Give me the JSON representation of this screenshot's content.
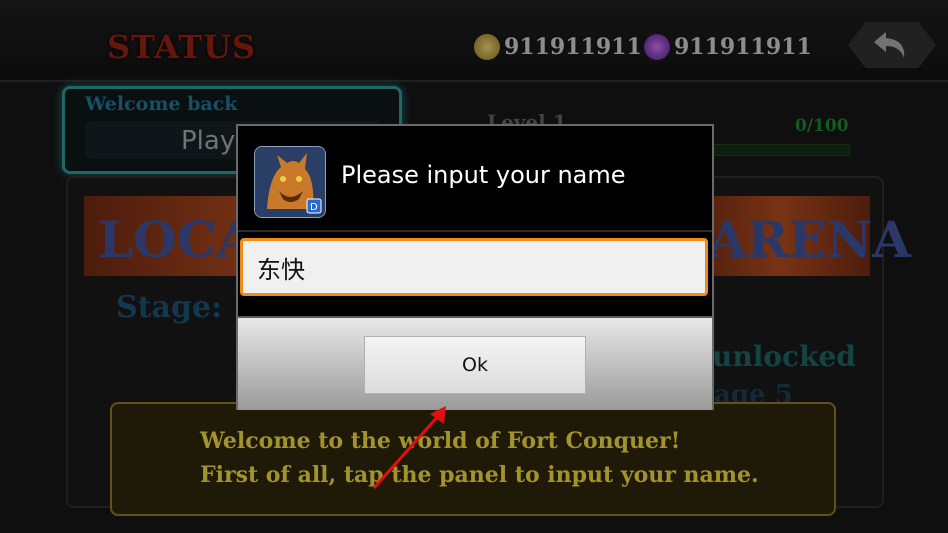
{
  "header": {
    "title": "STATUS",
    "gold_amount": "911911911",
    "gem_amount": "911911911",
    "back_icon": "back-arrow-icon"
  },
  "profile": {
    "welcome_label": "Welcome back",
    "player_name": "Player",
    "level_label": "Level 1",
    "xp_progress_text": "0/100",
    "xp_progress": 0
  },
  "modes": {
    "local_title": "LOCAL",
    "arena_title": "ARENA",
    "stage_label": "Stage: 1",
    "unlock_text": "unlocked",
    "stage_requirement": "age 5"
  },
  "tutorial": {
    "line1": "Welcome to the world of Fort Conquer!",
    "line2": "First of all, tap the panel to input your name."
  },
  "dialog": {
    "title": "Please input your name",
    "input_value": "东快",
    "ok_label": "Ok",
    "app_icon": "werewolf-app-icon",
    "accent_color": "#f08a1a"
  },
  "annotation": {
    "arrow_color": "#e01010"
  }
}
